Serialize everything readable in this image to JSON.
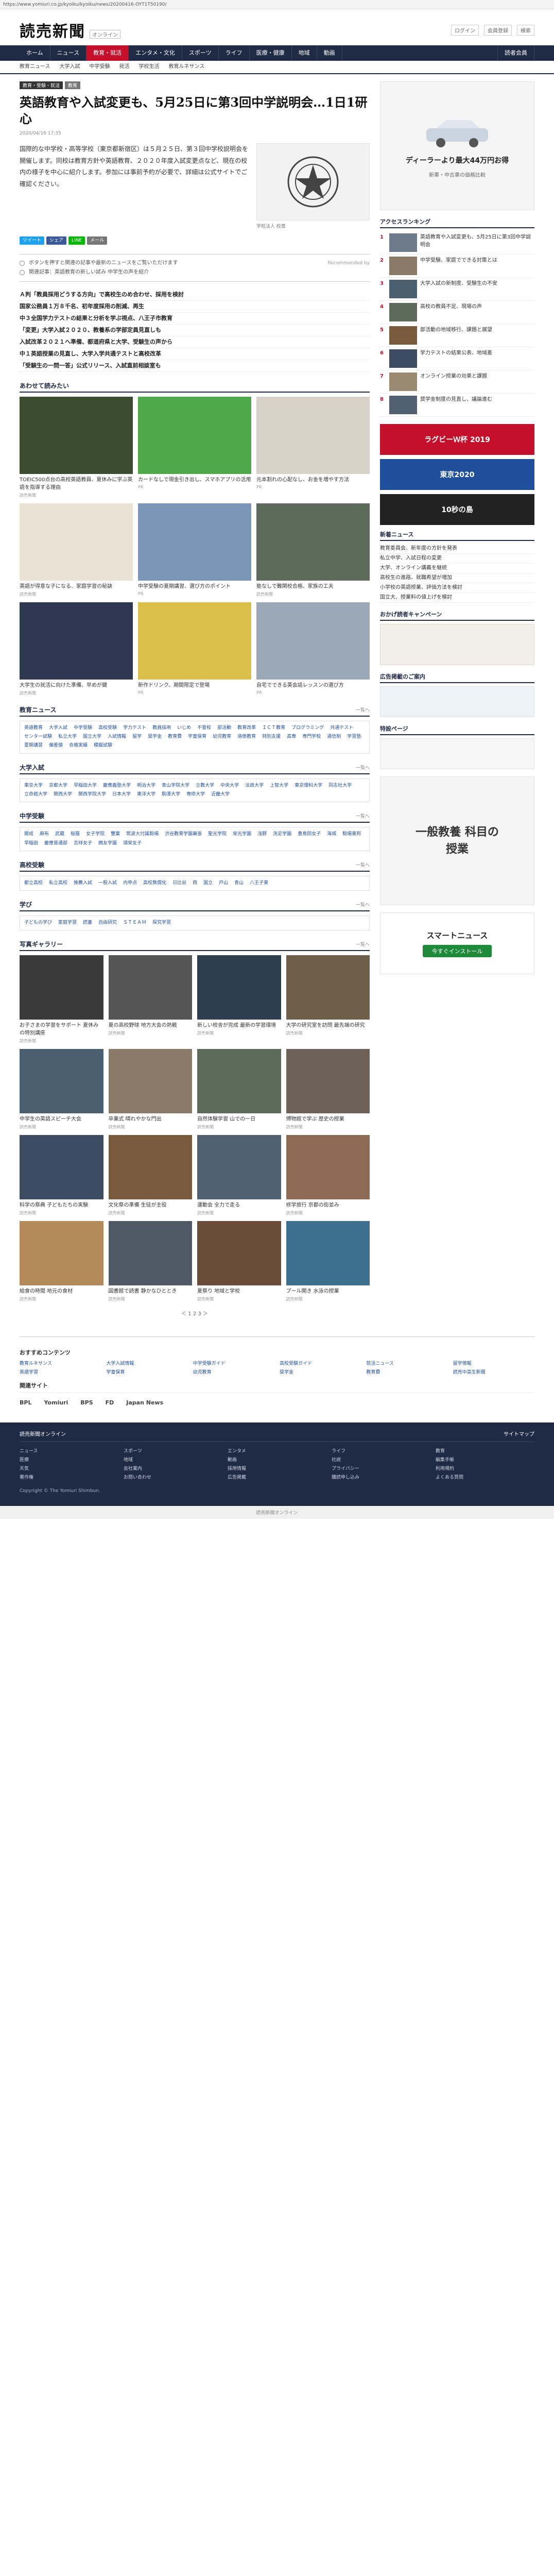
{
  "url": "https://www.yomiuri.co.jp/kyoiku/kyoiku/news/20200416-OYT1T50190/",
  "header": {
    "logo": "読売新聞",
    "logo_sub": "オンライン",
    "links": [
      "ログイン",
      "会員登録",
      "検索"
    ]
  },
  "gnav": [
    {
      "label": "ホーム",
      "active": false
    },
    {
      "label": "ニュース",
      "active": false
    },
    {
      "label": "教育・就活",
      "active": true
    },
    {
      "label": "エンタメ・文化",
      "active": false
    },
    {
      "label": "スポーツ",
      "active": false
    },
    {
      "label": "ライフ",
      "active": false
    },
    {
      "label": "医療・健康",
      "active": false
    },
    {
      "label": "地域",
      "active": false
    },
    {
      "label": "動画",
      "active": false
    },
    {
      "label": "読者会員",
      "active": false
    }
  ],
  "subnav": [
    "教育ニュース",
    "大学入試",
    "中学受験",
    "就活",
    "学校生活",
    "教育ルネサンス"
  ],
  "crumb": {
    "tag1": "教育・受験・就活",
    "tag2": "教育"
  },
  "article": {
    "title": "英語教育や入試変更も、5月25日に第3回中学説明会…1日1研心",
    "date": "2020/04/16 17:35",
    "body": "国際的な中学校・高等学校（東京都新宿区）は５月２５日、第３回中学校説明会を開催します。同校は教育方針や英語教育、２０２０年度入試変更点など、現在の校内の様子を中心に紹介します。参加には事前予約が必要で、詳細は公式サイトでご確認ください。",
    "photo_caption": "学校法人 校章",
    "share": [
      {
        "label": "ツイート",
        "color": "#1da1f2"
      },
      {
        "label": "シェア",
        "color": "#3b5998"
      },
      {
        "label": "LINE",
        "color": "#00b900"
      },
      {
        "label": "メール",
        "color": "#777777"
      }
    ]
  },
  "related": [
    {
      "text": "ボタンを押すと関連の記事や最新のニュースをご覧いただけます",
      "right": "Recommended by"
    },
    {
      "text": "関連記事：英語教育の新しい試み 中学生の声を紹介",
      "right": ""
    }
  ],
  "headlines": [
    "Ａ判「教員採用どうする方向」で高校生のめ合わせ、採用を検討",
    "国家公務員１万８千名、初年度採用の削減、再生",
    "中３全国学力テストの結果と分析を学ぶ視点、八王子市教育",
    "「変更」大学入試２０２０、教養系の学部定員見直しも",
    "入試改革２０２１へ準備、都道府県と大学、受験生の声から",
    "中１英語授業の見直し、大学入学共通テストと高校改革",
    "「受験生の一問一答」公式リリース、入試直前相談室も"
  ],
  "sections": {
    "recommend": "あわせて読みたい",
    "tags_title": "教育ニュース",
    "tags_title2": "大学入試",
    "tags_title3": "中学受験",
    "tags_title4": "高校受験",
    "tags_title5": "学び",
    "photo_title": "写真ギャラリー",
    "more": "一覧へ"
  },
  "recommend_cards": [
    {
      "cap": "TOEIC500点台の高校英語教員、夏休みに学ぶ英語を指導する理由",
      "src": "読売新聞",
      "color": "#3b4d2e"
    },
    {
      "cap": "カードなしで現金引き出し、スマホアプリの活用",
      "src": "PR",
      "color": "#4fa84a"
    },
    {
      "cap": "元本割れの心配なし、お金を増やす方法",
      "src": "PR",
      "color": "#d8d1c7"
    },
    {
      "cap": "英語が得意な子になる、家庭学習の秘訣",
      "src": "読売新聞",
      "color": "#e9e2d5"
    },
    {
      "cap": "中学受験の夏期講習、選び方のポイント",
      "src": "PR",
      "color": "#7c96b8"
    },
    {
      "cap": "塾なしで難関校合格、家族の工夫",
      "src": "読売新聞",
      "color": "#5c6b5a"
    },
    {
      "cap": "大学生の就活に向けた準備、早めが鍵",
      "src": "読売新聞",
      "color": "#2e3850"
    },
    {
      "cap": "新作ドリンク、期間限定で登場",
      "src": "PR",
      "color": "#d8c04a"
    },
    {
      "cap": "自宅でできる英会話レッスンの選び方",
      "src": "PR",
      "color": "#9ba8b5"
    }
  ],
  "tag_rows_1": [
    "英語教育",
    "大学入試",
    "中学受験",
    "高校受験",
    "学力テスト",
    "教員採用",
    "いじめ",
    "不登校",
    "部活動",
    "教育改革",
    "ＩＣＴ教育",
    "プログラミング",
    "共通テスト",
    "センター試験",
    "私立大学",
    "国立大学",
    "入試情報",
    "留学",
    "奨学金",
    "教育費",
    "学童保育",
    "幼児教育",
    "道徳教育",
    "特別支援",
    "高専",
    "専門学校",
    "通信制",
    "学習塾",
    "夏期講習",
    "偏差値",
    "合格実績",
    "模擬試験"
  ],
  "tag_rows_2": [
    "東京大学",
    "京都大学",
    "早稲田大学",
    "慶應義塾大学",
    "明治大学",
    "青山学院大学",
    "立教大学",
    "中央大学",
    "法政大学",
    "上智大学",
    "東京理科大学",
    "同志社大学",
    "立命館大学",
    "関西大学",
    "関西学院大学",
    "日本大学",
    "東洋大学",
    "駒澤大学",
    "専修大学",
    "近畿大学"
  ],
  "tag_rows_3": [
    "開成",
    "麻布",
    "武蔵",
    "桜蔭",
    "女子学院",
    "雙葉",
    "筑波大付属駒場",
    "渋谷教育学園幕張",
    "聖光学院",
    "栄光学園",
    "浅野",
    "洗足学園",
    "豊島岡女子",
    "海城",
    "駒場東邦",
    "早稲田",
    "慶應普通部",
    "吉祥女子",
    "鴎友学園",
    "頌栄女子"
  ],
  "tag_rows_4": [
    "都立高校",
    "私立高校",
    "推薦入試",
    "一般入試",
    "内申点",
    "高校無償化",
    "日比谷",
    "西",
    "国立",
    "戸山",
    "青山",
    "八王子東"
  ],
  "tag_rows_5": [
    "子どもの学び",
    "家庭学習",
    "読書",
    "自由研究",
    "ＳＴＥＡＭ",
    "探究学習"
  ],
  "gallery": [
    {
      "cap": "お子さまの学習をサポート 夏休みの特別講座",
      "src": "読売新聞",
      "color": "#3a3a3a"
    },
    {
      "cap": "夏の高校野球 地方大会の熱戦",
      "src": "読売新聞",
      "color": "#555555"
    },
    {
      "cap": "新しい校舎が完成 最新の学習環境",
      "src": "読売新聞",
      "color": "#2f3e4f"
    },
    {
      "cap": "大学の研究室を訪問 最先端の研究",
      "src": "読売新聞",
      "color": "#6f5e4a"
    },
    {
      "cap": "中学生の英語スピーチ大会",
      "src": "読売新聞",
      "color": "#4a5f6f"
    },
    {
      "cap": "卒業式 晴れやかな門出",
      "src": "読売新聞",
      "color": "#8a7b69"
    },
    {
      "cap": "自然体験学習 山での一日",
      "src": "読売新聞",
      "color": "#5c6b5a"
    },
    {
      "cap": "博物館で学ぶ 歴史の授業",
      "src": "読売新聞",
      "color": "#6e6258"
    },
    {
      "cap": "科学の祭典 子どもたちの実験",
      "src": "読売新聞",
      "color": "#3d4b63"
    },
    {
      "cap": "文化祭の準備 生徒が主役",
      "src": "読売新聞",
      "color": "#7a5a3c"
    },
    {
      "cap": "運動会 全力で走る",
      "src": "読売新聞",
      "color": "#506070"
    },
    {
      "cap": "修学旅行 京都の街並み",
      "src": "読売新聞",
      "color": "#8c6a54"
    },
    {
      "cap": "給食の時間 地元の食材",
      "src": "読売新聞",
      "color": "#b58a5a"
    },
    {
      "cap": "図書館で読書 静かなひととき",
      "src": "読売新聞",
      "color": "#4f5a66"
    },
    {
      "cap": "夏祭り 地域と学校",
      "src": "読売新聞",
      "color": "#6b4b3a"
    },
    {
      "cap": "プール開き 水泳の授業",
      "src": "読売新聞",
      "color": "#3f6f8f"
    }
  ],
  "pager": "＜ 1 2 3 ＞",
  "side": {
    "ad_title": "ディーラーより最大44万円お得",
    "ad_sub": "新車・中古車の価格比較",
    "ranking_title": "アクセスランキング",
    "ranking": [
      "英語教育や入試変更も、5月25日に第3回中学説明会",
      "中学受験、家庭でできる対策とは",
      "大学入試の新制度、受験生の不安",
      "高校の教員不足、現場の声",
      "部活動の地域移行、課題と展望",
      "学力テストの結果公表、地域差",
      "オンライン授業の効果と課題",
      "奨学金制度の見直し、議論進む"
    ],
    "banner1": "ラグビーＷ杯 2019",
    "banner2": "東京2020",
    "banner3": "10秒の島",
    "news_title": "新着ニュース",
    "news_list": [
      "教育委員会、新年度の方針を発表",
      "私立中学、入試日程の変更",
      "大学、オンライン講義を継続",
      "高校生の進路、就職希望が増加",
      "小学校の英語授業、評価方法を検討",
      "国立大、授業料の値上げを検討"
    ],
    "campaign_title": "おかげ読者キャンペーン",
    "promo_title": "広告掲載のご案内",
    "special_title": "特設ページ",
    "big_ad": "一般教養 科目の授業",
    "smart_title": "スマートニュース",
    "smart_btn": "今すぐインストール"
  },
  "footer": {
    "links_title": "おすすめコンテンツ",
    "links": [
      "教育ルネサンス",
      "大学入試情報",
      "中学受験ガイド",
      "高校受験ガイド",
      "就活ニュース",
      "留学情報",
      "英語学習",
      "学童保育",
      "幼児教育",
      "奨学金",
      "教育費",
      "読売中高生新聞"
    ],
    "partners_title": "関連サイト",
    "partners": [
      "BPL",
      "Yomiuri",
      "BPS",
      "FD",
      "Japan News"
    ],
    "dark_top": [
      "読売新聞オンライン",
      "サイトマップ"
    ],
    "dark_links": [
      "ニュース",
      "スポーツ",
      "エンタメ",
      "ライフ",
      "教育",
      "医療",
      "地域",
      "動画",
      "社説",
      "編集手帳",
      "天気",
      "会社案内",
      "採用情報",
      "プライバシー",
      "利用規約",
      "著作権",
      "お問い合わせ",
      "広告掲載",
      "購読申し込み",
      "よくある質問"
    ],
    "copy": "Copyright © The Yomiuri Shimbun.",
    "bottom": "読売新聞オンライン"
  }
}
